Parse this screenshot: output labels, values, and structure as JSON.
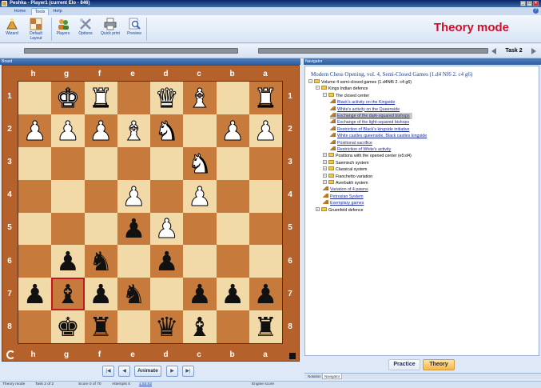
{
  "window": {
    "title": "Peshka - Player1 (current Elo - 846)"
  },
  "ribbon": {
    "tabs": [
      "Home",
      "Tools",
      "Help"
    ],
    "active_tab": "Tools",
    "buttons": {
      "wizard": "Wizard",
      "default_layout_1": "Default",
      "default_layout_2": "Layout",
      "players": "Players",
      "options": "Options",
      "quick_print": "Quick print",
      "preview": "Preview"
    }
  },
  "mode_title": "Theory mode",
  "task": {
    "label": "Task 2"
  },
  "board": {
    "panel_title": "Board",
    "files": [
      "h",
      "g",
      "f",
      "e",
      "d",
      "c",
      "b",
      "a"
    ],
    "ranks": [
      "1",
      "2",
      "3",
      "4",
      "5",
      "6",
      "7",
      "8"
    ],
    "highlighted_square": "g7",
    "rows": [
      [
        "",
        "wK",
        "wR",
        "",
        "wQ",
        "wB",
        "",
        "wR"
      ],
      [
        "wP",
        "wP",
        "wP",
        "wB",
        "wN",
        "",
        "wP",
        "wP"
      ],
      [
        "",
        "",
        "",
        "",
        "",
        "wN",
        "",
        ""
      ],
      [
        "",
        "",
        "",
        "wP",
        "",
        "wP",
        "",
        ""
      ],
      [
        "",
        "",
        "",
        "bP",
        "wP",
        "",
        "",
        ""
      ],
      [
        "",
        "bP",
        "bN",
        "",
        "bP",
        "",
        "",
        ""
      ],
      [
        "bP",
        "bB",
        "bP",
        "bN",
        "",
        "bP",
        "bP",
        "bP"
      ],
      [
        "",
        "bK",
        "bR",
        "",
        "bQ",
        "bB",
        "",
        "bR"
      ]
    ]
  },
  "navigation": {
    "animate": "Animate"
  },
  "navigator": {
    "panel_title": "Navigator",
    "heading": "Modern Chess Opening, vol. 4, Semi-Closed Games (1.d4 Nf6 2. c4 g6)",
    "tree": [
      {
        "label": "Volume 4 semi-closed games (1.d4Nf6 2. c4 g6)",
        "kind": "folder",
        "expander": "−",
        "level": 0
      },
      {
        "label": "Kings Indian defence",
        "kind": "folder",
        "expander": "−",
        "level": 1
      },
      {
        "label": "The closed center",
        "kind": "folder",
        "expander": "−",
        "level": 2
      },
      {
        "label": "Black's activity on the Kingside",
        "kind": "task",
        "level": 3
      },
      {
        "label": "White's activity on the Queenside",
        "kind": "task",
        "level": 3
      },
      {
        "label": "Exchange of the dark-squared bishops",
        "kind": "task",
        "level": 3,
        "selected": true
      },
      {
        "label": "Exchange of the light-squared bishops",
        "kind": "task",
        "level": 3
      },
      {
        "label": "Restriction of Black's kingside initiative",
        "kind": "task",
        "level": 3
      },
      {
        "label": "White castles queenside, Black castles kingside",
        "kind": "task",
        "level": 3
      },
      {
        "label": "Positional sacrifice",
        "kind": "task",
        "level": 3
      },
      {
        "label": "Restriction of White's activity",
        "kind": "task",
        "level": 3
      },
      {
        "label": "Positions with the opened center (e5:d4)",
        "kind": "folder",
        "expander": "+",
        "level": 2
      },
      {
        "label": "Saemisch system",
        "kind": "folder",
        "expander": "+",
        "level": 2
      },
      {
        "label": "Classical system",
        "kind": "folder",
        "expander": "+",
        "level": 2
      },
      {
        "label": "Fianchetto variation",
        "kind": "folder",
        "expander": "+",
        "level": 2
      },
      {
        "label": "Averbakh system",
        "kind": "folder",
        "expander": "+",
        "level": 2
      },
      {
        "label": "Variation of 4 pawns",
        "kind": "task",
        "level": 2
      },
      {
        "label": "Petrosian System",
        "kind": "task",
        "level": 2
      },
      {
        "label": "Exemplary games",
        "kind": "task",
        "level": 2
      },
      {
        "label": "Gruenfeld defence",
        "kind": "folder",
        "expander": "+",
        "level": 1
      }
    ],
    "practice_button": "Practice",
    "theory_button": "Theory",
    "bottom_tabs": [
      "Notation",
      "Navigator"
    ],
    "active_bottom_tab": "Navigator"
  },
  "status": {
    "mode": "Theory mode",
    "task": "Task 2 of 2",
    "score": "Score 0 of 70",
    "attempts": "Attempts 0",
    "time": "1:53:02",
    "engine": "Engine score"
  }
}
